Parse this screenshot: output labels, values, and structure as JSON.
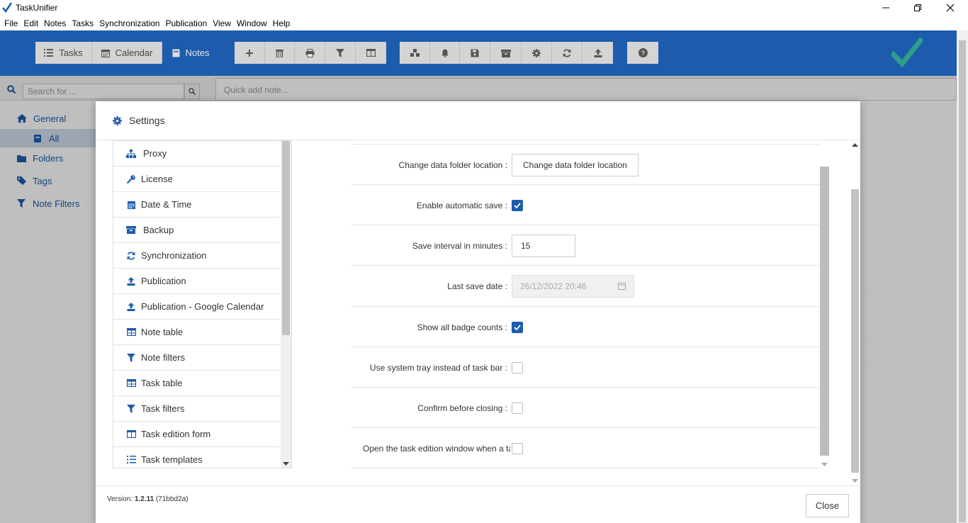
{
  "app": {
    "title": "TaskUnifier"
  },
  "menu": [
    "File",
    "Edit",
    "Notes",
    "Tasks",
    "Synchronization",
    "Publication",
    "View",
    "Window",
    "Help"
  ],
  "toolbar": {
    "tasks_label": "Tasks",
    "calendar_label": "Calendar",
    "notes_label": "Notes"
  },
  "search": {
    "placeholder": "Search for ...",
    "quickadd_placeholder": "Quick add note..."
  },
  "leftnav": {
    "general": "General",
    "all": "All",
    "folders": "Folders",
    "tags": "Tags",
    "note_filters": "Note Filters"
  },
  "settings": {
    "title": "Settings",
    "categories": [
      {
        "label": "Proxy",
        "icon": "sitemap-icon"
      },
      {
        "label": "License",
        "icon": "key-icon"
      },
      {
        "label": "Date & Time",
        "icon": "calendar-icon"
      },
      {
        "label": "Backup",
        "icon": "archive-icon"
      },
      {
        "label": "Synchronization",
        "icon": "sync-icon"
      },
      {
        "label": "Publication",
        "icon": "upload-icon"
      },
      {
        "label": "Publication - Google Calendar",
        "icon": "upload-icon"
      },
      {
        "label": "Note table",
        "icon": "table-icon"
      },
      {
        "label": "Note filters",
        "icon": "filter-icon"
      },
      {
        "label": "Task table",
        "icon": "table-icon"
      },
      {
        "label": "Task filters",
        "icon": "filter-icon"
      },
      {
        "label": "Task edition form",
        "icon": "columns-icon"
      },
      {
        "label": "Task templates",
        "icon": "list-icon"
      }
    ],
    "rows": {
      "data_folder": {
        "label": "Change data folder location",
        "button": "Change data folder location"
      },
      "auto_save": {
        "label": "Enable automatic save",
        "checked": true
      },
      "save_interval": {
        "label": "Save interval in minutes",
        "value": "15"
      },
      "last_save": {
        "label": "Last save date",
        "value": "26/12/2022 20:46"
      },
      "badge_counts": {
        "label": "Show all badge counts",
        "checked": true
      },
      "system_tray": {
        "label": "Use system tray instead of task bar",
        "checked": false
      },
      "confirm_close": {
        "label": "Confirm before closing",
        "checked": false
      },
      "open_edition": {
        "label": "Open the task edition window when a ta",
        "checked": false
      }
    },
    "version_prefix": "Version: ",
    "version_number": "1.2.11",
    "version_build": " (71bbd2a)",
    "close_label": "Close"
  },
  "colors": {
    "brand": "#1d5cad",
    "check": "#2e9e8a"
  }
}
